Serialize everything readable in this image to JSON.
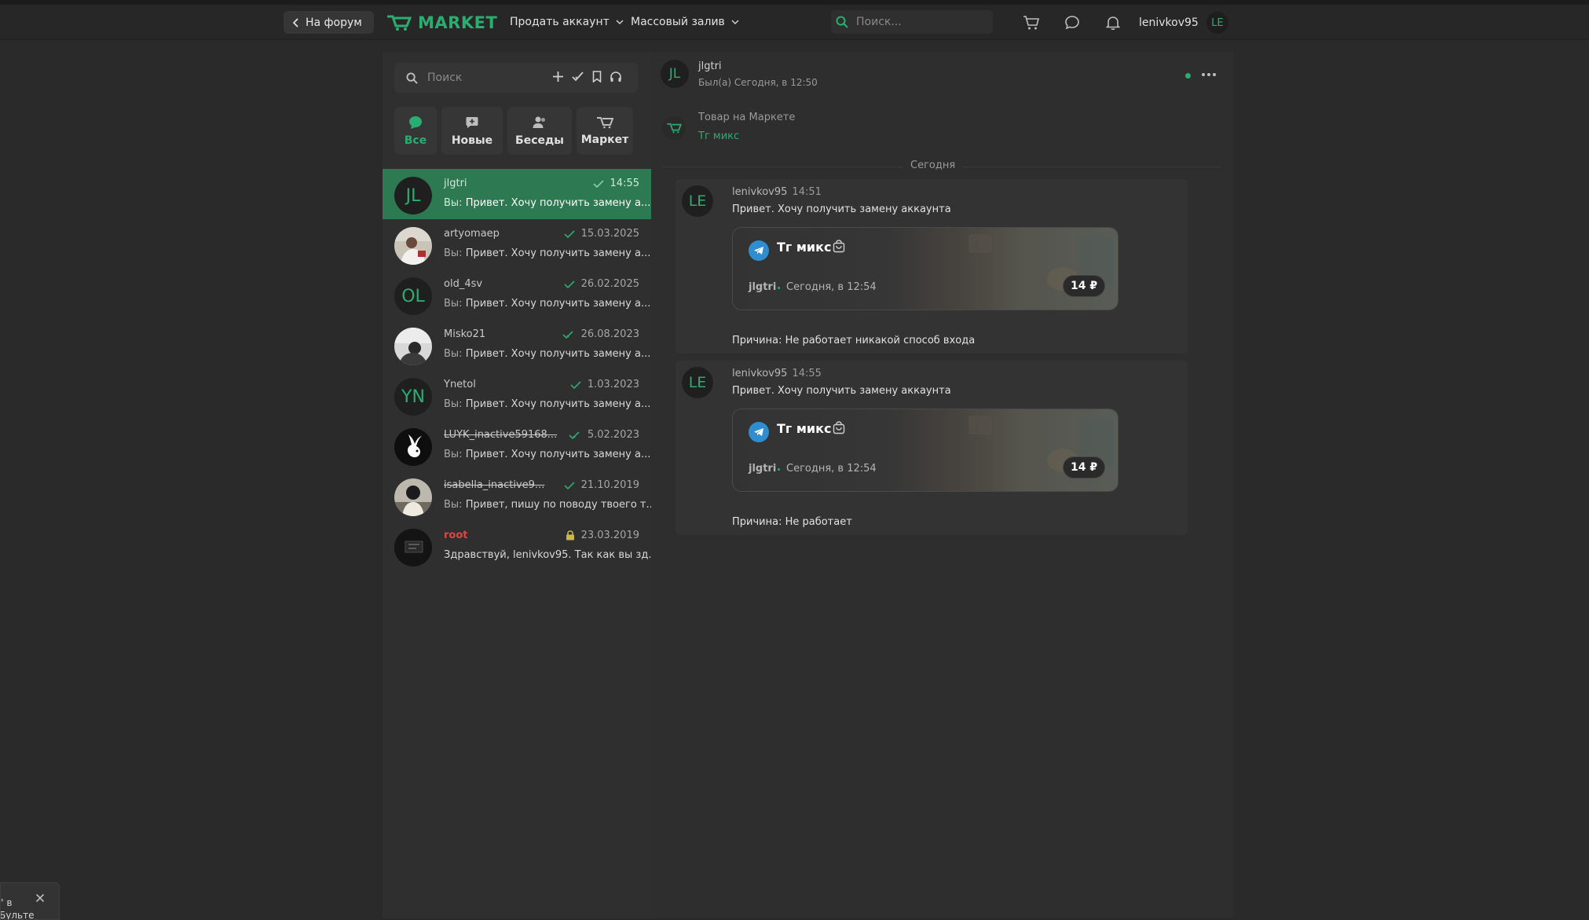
{
  "topbar": {
    "back_label": "На форум",
    "logo_text": "MARKET",
    "menu": [
      {
        "label": "Продать аккаунт"
      },
      {
        "label": "Массовый залив"
      }
    ],
    "search_placeholder": "Поиск...",
    "username": "lenivkov95",
    "user_initials": "LE"
  },
  "sidebar": {
    "search_placeholder": "Поиск",
    "tabs": [
      {
        "label": "Все",
        "active": true
      },
      {
        "label": "Новые"
      },
      {
        "label": "Беседы"
      },
      {
        "label": "Маркет"
      }
    ],
    "conversations": [
      {
        "name": "jlgtri",
        "initials": "JL",
        "date": "14:55",
        "you": "Вы:",
        "preview": "Привет. Хочу получить замену а...",
        "status": "read"
      },
      {
        "name": "artyomaep",
        "initials": "",
        "date": "15.03.2025",
        "you": "Вы:",
        "preview": "Привет. Хочу получить замену а...",
        "status": "read"
      },
      {
        "name": "old_4sv",
        "initials": "OL",
        "date": "26.02.2025",
        "you": "Вы:",
        "preview": "Привет. Хочу получить замену а...",
        "status": "read"
      },
      {
        "name": "Misko21",
        "initials": "",
        "date": "26.08.2023",
        "you": "Вы:",
        "preview": "Привет. Хочу получить замену а...",
        "status": "read-double"
      },
      {
        "name": "Ynetol",
        "initials": "YN",
        "date": "1.03.2023",
        "you": "Вы:",
        "preview": "Привет. Хочу получить замену а...",
        "status": "read"
      },
      {
        "name": "LUYK_inactive59168...",
        "initials": "",
        "date": "5.02.2023",
        "you": "Вы:",
        "preview": "Привет. Хочу получить замену а...",
        "status": "read-double"
      },
      {
        "name": "isabella_inactive9...",
        "initials": "",
        "date": "21.10.2019",
        "you": "Вы:",
        "preview": "Привет, пишу по поводу твоего т...",
        "status": "read"
      },
      {
        "name": "root",
        "initials": "",
        "date": "23.03.2019",
        "you": "",
        "preview": "Здравствуй, lenivkov95. Так как вы зд...",
        "status": "locked"
      }
    ]
  },
  "chat": {
    "partner_name": "jlgtri",
    "partner_initials": "JL",
    "partner_status": "Был(а) Сегодня, в 12:50",
    "product_label": "Товар на Маркете",
    "product_link": "Тг микс",
    "day_label": "Сегодня",
    "messages": [
      {
        "author": "lenivkov95",
        "initials": "LE",
        "time": "14:51",
        "text": "Привет. Хочу получить замену аккаунта",
        "card": {
          "title": "Тг микс",
          "seller": "jlgtri",
          "date": "Сегодня, в 12:54",
          "price": "14 ₽"
        },
        "reason": "Причина: Не работает никакой способ входа"
      },
      {
        "author": "lenivkov95",
        "initials": "LE",
        "time": "14:55",
        "text": "Привет. Хочу получить замену аккаунта",
        "card": {
          "title": "Тг микс",
          "seller": "jlgtri",
          "date": "Сегодня, в 12:54",
          "price": "14 ₽"
        },
        "reason": "Причина: Не работает"
      }
    ]
  },
  "toast": {
    "text": "\" в Бульте"
  },
  "colors": {
    "accent": "#2bad72",
    "active_row": "#2d7a52",
    "background": "#2a2a2a",
    "danger": "#e04545"
  }
}
